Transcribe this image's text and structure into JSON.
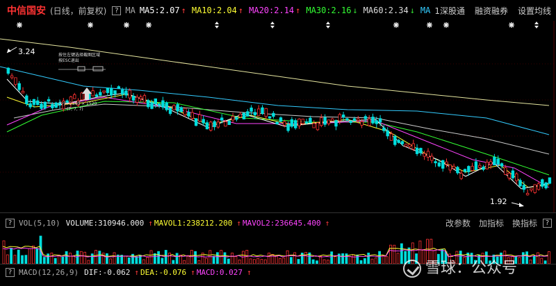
{
  "header": {
    "stock_name": "中信国安",
    "period": "(日线，前复权)",
    "help": "?",
    "ma_label": "MA",
    "indicators": [
      {
        "label": "MA5:2.07",
        "color": "#ffffff",
        "dir": "up"
      },
      {
        "label": "MA10:2.04",
        "color": "#ffff33",
        "dir": "up"
      },
      {
        "label": "MA20:2.14",
        "color": "#ff44ff",
        "dir": "up"
      },
      {
        "label": "MA30:2.16",
        "color": "#33ff33",
        "dir": "down"
      },
      {
        "label": "MA60:2.34",
        "color": "#dddddd",
        "dir": "down"
      },
      {
        "label": "MA",
        "color": "#33ccff",
        "dir": "none"
      }
    ],
    "menu": [
      "1深股通",
      "融资融券",
      "设置均线"
    ]
  },
  "main": {
    "high_label": "3.24",
    "low_label": "1.92",
    "popup_lines": [
      "按住左键选择截图区域",
      "按ESC退出",
      "大小: 2560 × 1520",
      "(7, 7, 7)"
    ]
  },
  "volume": {
    "name": "VOL(5,10)",
    "volume": "VOLUME:310946.000",
    "mavol1": "MAVOL1:238212.200",
    "mavol2": "MAVOL2:236645.400",
    "tools": [
      "改参数",
      "加指标",
      "换指标"
    ]
  },
  "macd": {
    "name": "MACD(12,26,9)",
    "dif": "DIF:-0.062",
    "dea": "DEA:-0.076",
    "macd": "MACD:0.027"
  },
  "watermark": {
    "text": "雪球：公众号"
  },
  "colors": {
    "up": "#ff3333",
    "down": "#00dddd",
    "ma5": "#ffffff",
    "ma10": "#ffff33",
    "ma20": "#ff44ff",
    "ma30": "#33ff33",
    "ma60": "#cccccc",
    "ma_cyan": "#33ccff",
    "ma_long": "#e6e6a0"
  }
}
